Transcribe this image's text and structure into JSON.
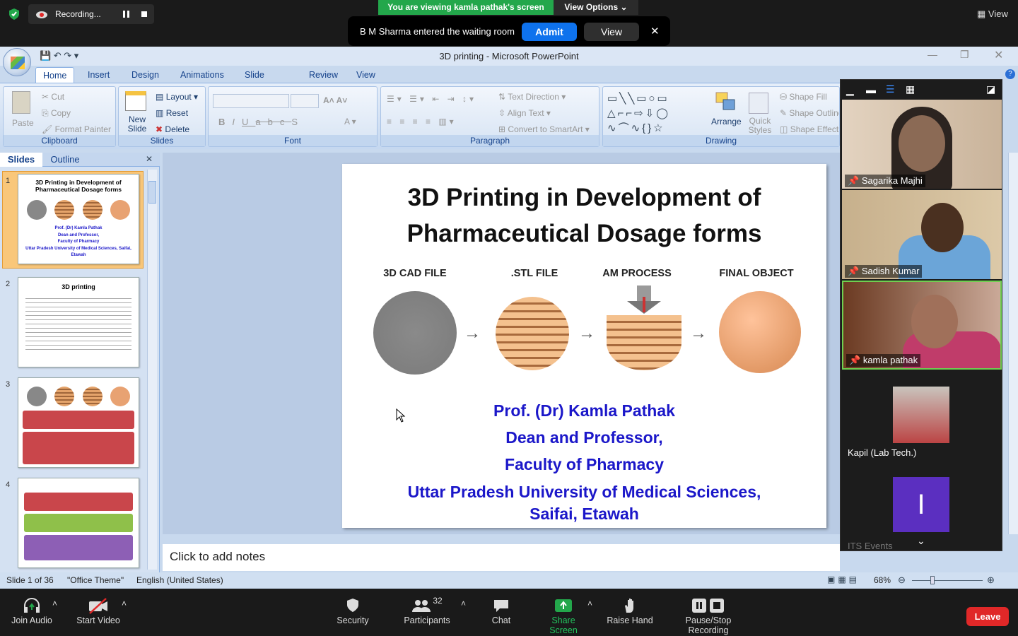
{
  "zoom": {
    "recording": "Recording...",
    "banner": "You are viewing kamla pathak's screen",
    "view_options": "View Options",
    "view": "View",
    "waiting": {
      "text": "B M Sharma entered the waiting room",
      "admit": "Admit",
      "view": "View"
    },
    "bottom": {
      "join_audio": "Join Audio",
      "start_video": "Start Video",
      "security": "Security",
      "participants": "Participants",
      "participant_count": "32",
      "chat": "Chat",
      "share_screen": "Share Screen",
      "raise_hand": "Raise Hand",
      "pause_stop": "Pause/Stop Recording",
      "leave": "Leave"
    },
    "participants": [
      {
        "name": "Sagarika Majhi"
      },
      {
        "name": "Sadish Kumar"
      },
      {
        "name": "kamla pathak"
      },
      {
        "name": "Kapil (Lab Tech.)"
      },
      {
        "name": "ITS Events",
        "initial": "I"
      }
    ],
    "accent": "#0e72ed",
    "banner_color": "#23a74b"
  },
  "ppt": {
    "window_title": "3D printing - Microsoft PowerPoint",
    "tabs": [
      "Home",
      "Insert",
      "Design",
      "Animations",
      "Slide Show",
      "Review",
      "View"
    ],
    "ribbon": {
      "clipboard": {
        "label": "Clipboard",
        "paste": "Paste",
        "cut": "Cut",
        "copy": "Copy",
        "format_painter": "Format Painter"
      },
      "slides": {
        "label": "Slides",
        "new_slide": "New Slide",
        "layout": "Layout",
        "reset": "Reset",
        "delete": "Delete"
      },
      "font": {
        "label": "Font"
      },
      "paragraph": {
        "label": "Paragraph",
        "text_direction": "Text Direction",
        "align_text": "Align Text",
        "convert": "Convert to SmartArt"
      },
      "drawing": {
        "label": "Drawing",
        "arrange": "Arrange",
        "quick_styles": "Quick Styles",
        "shape_fill": "Shape Fill",
        "shape_outline": "Shape Outline",
        "shape_effects": "Shape Effects"
      }
    },
    "panel_tabs": {
      "slides": "Slides",
      "outline": "Outline"
    },
    "thumbs": {
      "t1": {
        "num": "1",
        "title": "3D Printing in Development of Pharmaceutical Dosage forms",
        "l1": "Prof. (Dr) Kamla Pathak",
        "l2": "Dean and Professor,",
        "l3": "Faculty of Pharmacy",
        "l4": "Uttar Pradesh University of Medical Sciences, Saifai, Etawah"
      },
      "t2": {
        "num": "2",
        "title": "3D printing"
      },
      "t3": {
        "num": "3"
      },
      "t4": {
        "num": "4"
      }
    },
    "slide": {
      "title1": "3D Printing in Development of",
      "title2": "Pharmaceutical Dosage forms",
      "steps": [
        "3D CAD FILE",
        ".STL FILE",
        "AM PROCESS",
        "FINAL OBJECT"
      ],
      "author": "Prof. (Dr) Kamla Pathak",
      "role": "Dean and Professor,",
      "faculty": "Faculty of Pharmacy",
      "univ": "Uttar Pradesh University of Medical Sciences,",
      "place": "Saifai, Etawah"
    },
    "notes": "Click to add notes",
    "status": {
      "slide": "Slide 1 of 36",
      "theme": "\"Office Theme\"",
      "lang": "English (United States)",
      "zoom": "68%"
    }
  }
}
